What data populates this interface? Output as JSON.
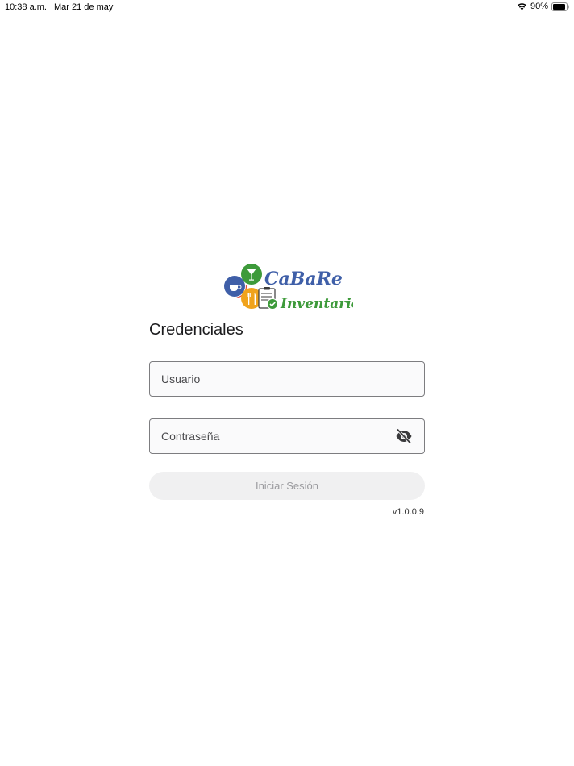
{
  "status_bar": {
    "time": "10:38 a.m.",
    "date": "Mar 21 de may",
    "battery": "90%"
  },
  "logo": {
    "brand_top": "CaBaRe",
    "brand_bottom": "Inventario",
    "colors": {
      "blue": "#3f5fa8",
      "green": "#3d9a3a",
      "orange": "#f0a31c"
    }
  },
  "login": {
    "title": "Credenciales",
    "username_placeholder": "Usuario",
    "password_placeholder": "Contraseña",
    "toggle_icon": "eye-off-icon",
    "submit_label": "Iniciar Sesión",
    "version": "v1.0.0.9"
  }
}
